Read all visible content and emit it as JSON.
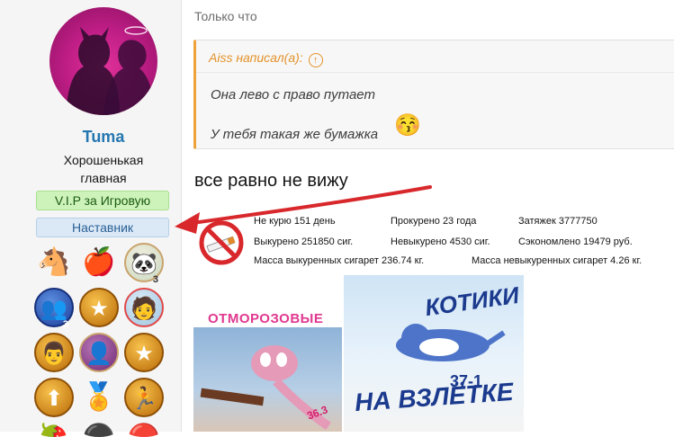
{
  "user": {
    "name": "Tuma",
    "title": "Хорошенькая главная",
    "banners": [
      "V.I.P за Игровую",
      "Наставник"
    ],
    "award_numbers": [
      "3",
      "3"
    ]
  },
  "post": {
    "time": "Только что",
    "quote": {
      "author": "Aiss написал(а):",
      "lines": [
        "Она лево с право путает",
        "У тебя такая же бумажка"
      ]
    },
    "text": "все равно не вижу"
  },
  "smoking_stats": {
    "row1": [
      "Не курю 151 день",
      "Прокурено 23 года",
      "Затяжек 3777750"
    ],
    "row2": [
      "Выкурено 251850 сиг.",
      "Невыкурено 4530 сиг.",
      "Сэкономлено 19479 руб."
    ],
    "row3": [
      "Масса выкуренных сигарет 236.74 кг.",
      "Масса невыкуренных сигарет 4.26 кг."
    ]
  },
  "images": {
    "pink_caption": "ОТМОРОЗОВЫЕ",
    "pink_number": "36.3",
    "cat_title": "КОТИКИ",
    "cat_issue": "37-1",
    "cat_subtitle": "НА ВЗЛЁТКЕ"
  },
  "colors": {
    "username": "#2577b1",
    "quote_accent": "#f0a23a",
    "arrow": "#d8282c",
    "vip_banner": "#cdf3ba",
    "mentor_banner": "#dbe9f7"
  }
}
